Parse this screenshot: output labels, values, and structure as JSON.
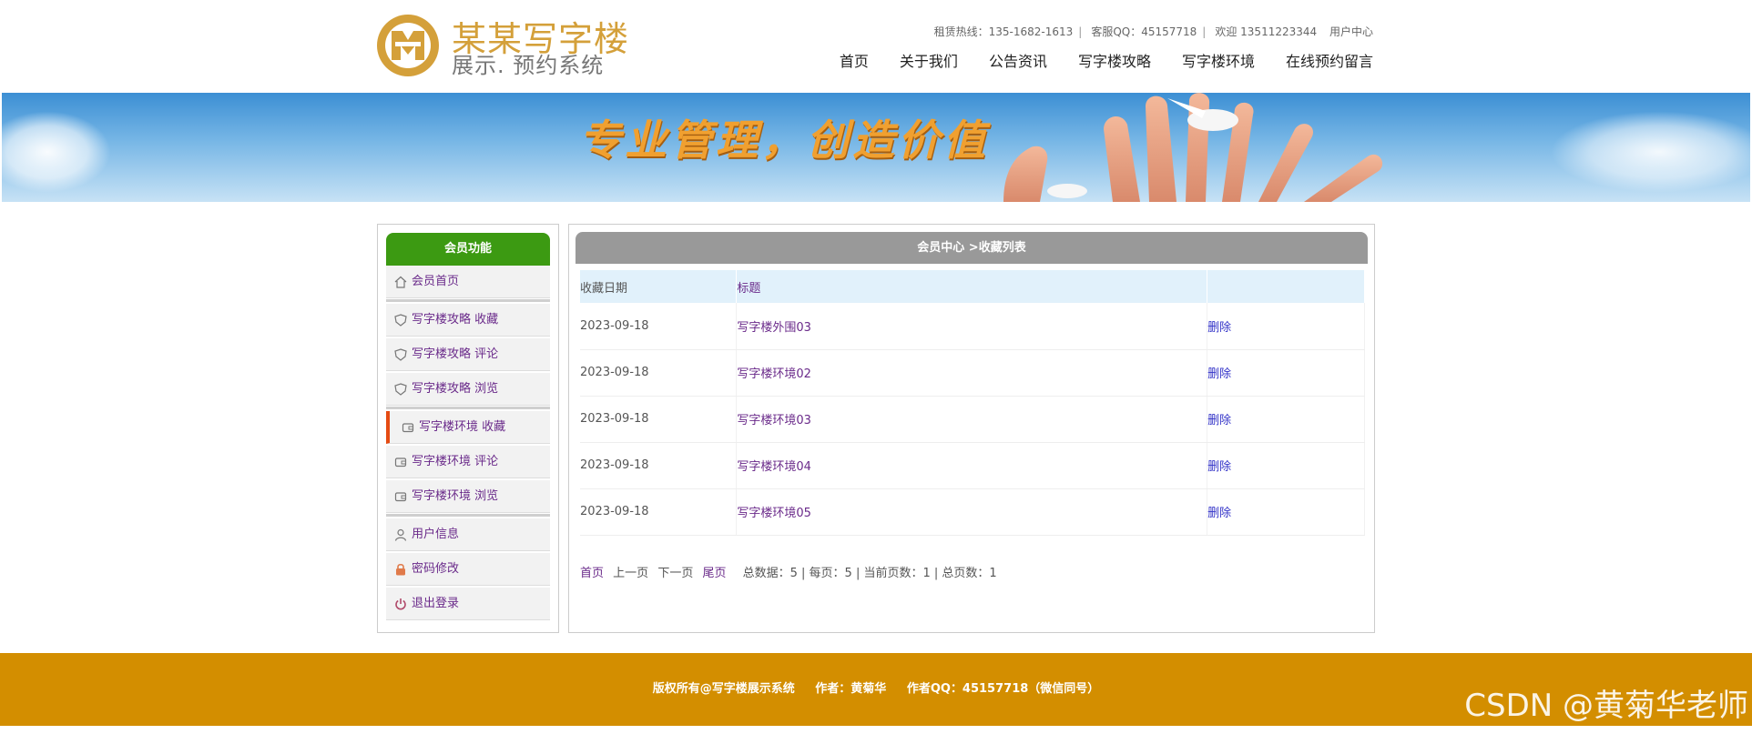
{
  "header": {
    "brand_title": "某某写字楼",
    "brand_subtitle": "展示. 预约系统",
    "hotline": "租赁热线：135-1682-1613",
    "qq": "客服QQ：45157718",
    "welcome": "欢迎 13511223344",
    "user_center": "用户中心"
  },
  "nav": {
    "items": [
      "首页",
      "关于我们",
      "公告资讯",
      "写字楼攻略",
      "写字楼环境",
      "在线预约留言"
    ]
  },
  "banner": {
    "slogan": "专业管理，创造价值"
  },
  "sidebar": {
    "title": "会员功能",
    "items": [
      {
        "label": "会员首页",
        "icon": "home-icon"
      },
      {
        "label": "写字楼攻略 收藏",
        "icon": "badge-icon"
      },
      {
        "label": "写字楼攻略 评论",
        "icon": "badge-icon"
      },
      {
        "label": "写字楼攻略 浏览",
        "icon": "badge-icon"
      },
      {
        "label": "写字楼环境 收藏",
        "icon": "wallet-icon"
      },
      {
        "label": "写字楼环境 评论",
        "icon": "wallet-icon"
      },
      {
        "label": "写字楼环境 浏览",
        "icon": "wallet-icon"
      },
      {
        "label": "用户信息",
        "icon": "user-icon"
      },
      {
        "label": "密码修改",
        "icon": "lock-icon"
      },
      {
        "label": "退出登录",
        "icon": "power-icon"
      }
    ]
  },
  "main": {
    "title": "会员中心 >收藏列表",
    "columns": [
      "收藏日期",
      "标题",
      ""
    ],
    "rows": [
      {
        "date": "2023-09-18",
        "title": "写字楼外围03",
        "action": "删除"
      },
      {
        "date": "2023-09-18",
        "title": "写字楼环境02",
        "action": "删除"
      },
      {
        "date": "2023-09-18",
        "title": "写字楼环境03",
        "action": "删除"
      },
      {
        "date": "2023-09-18",
        "title": "写字楼环境04",
        "action": "删除"
      },
      {
        "date": "2023-09-18",
        "title": "写字楼环境05",
        "action": "删除"
      }
    ],
    "pager": {
      "first": "首页",
      "prev": "上一页",
      "next": "下一页",
      "last": "尾页",
      "stats": "总数据：5 | 每页：5 | 当前页数：1 | 总页数：1"
    }
  },
  "footer": {
    "copyright": "版权所有@写字楼展示系统",
    "author": "作者：黄菊华",
    "author_qq": "作者QQ：45157718（微信同号）"
  },
  "watermark": "CSDN @黄菊华老师",
  "colors": {
    "brand_gold": "#d4a03a",
    "sidebar_header": "#3c9a12",
    "active_marker": "#e54b13",
    "footer_bg": "#d38e00",
    "link_purple": "#6a2a8a",
    "delete_blue": "#3434c8"
  }
}
